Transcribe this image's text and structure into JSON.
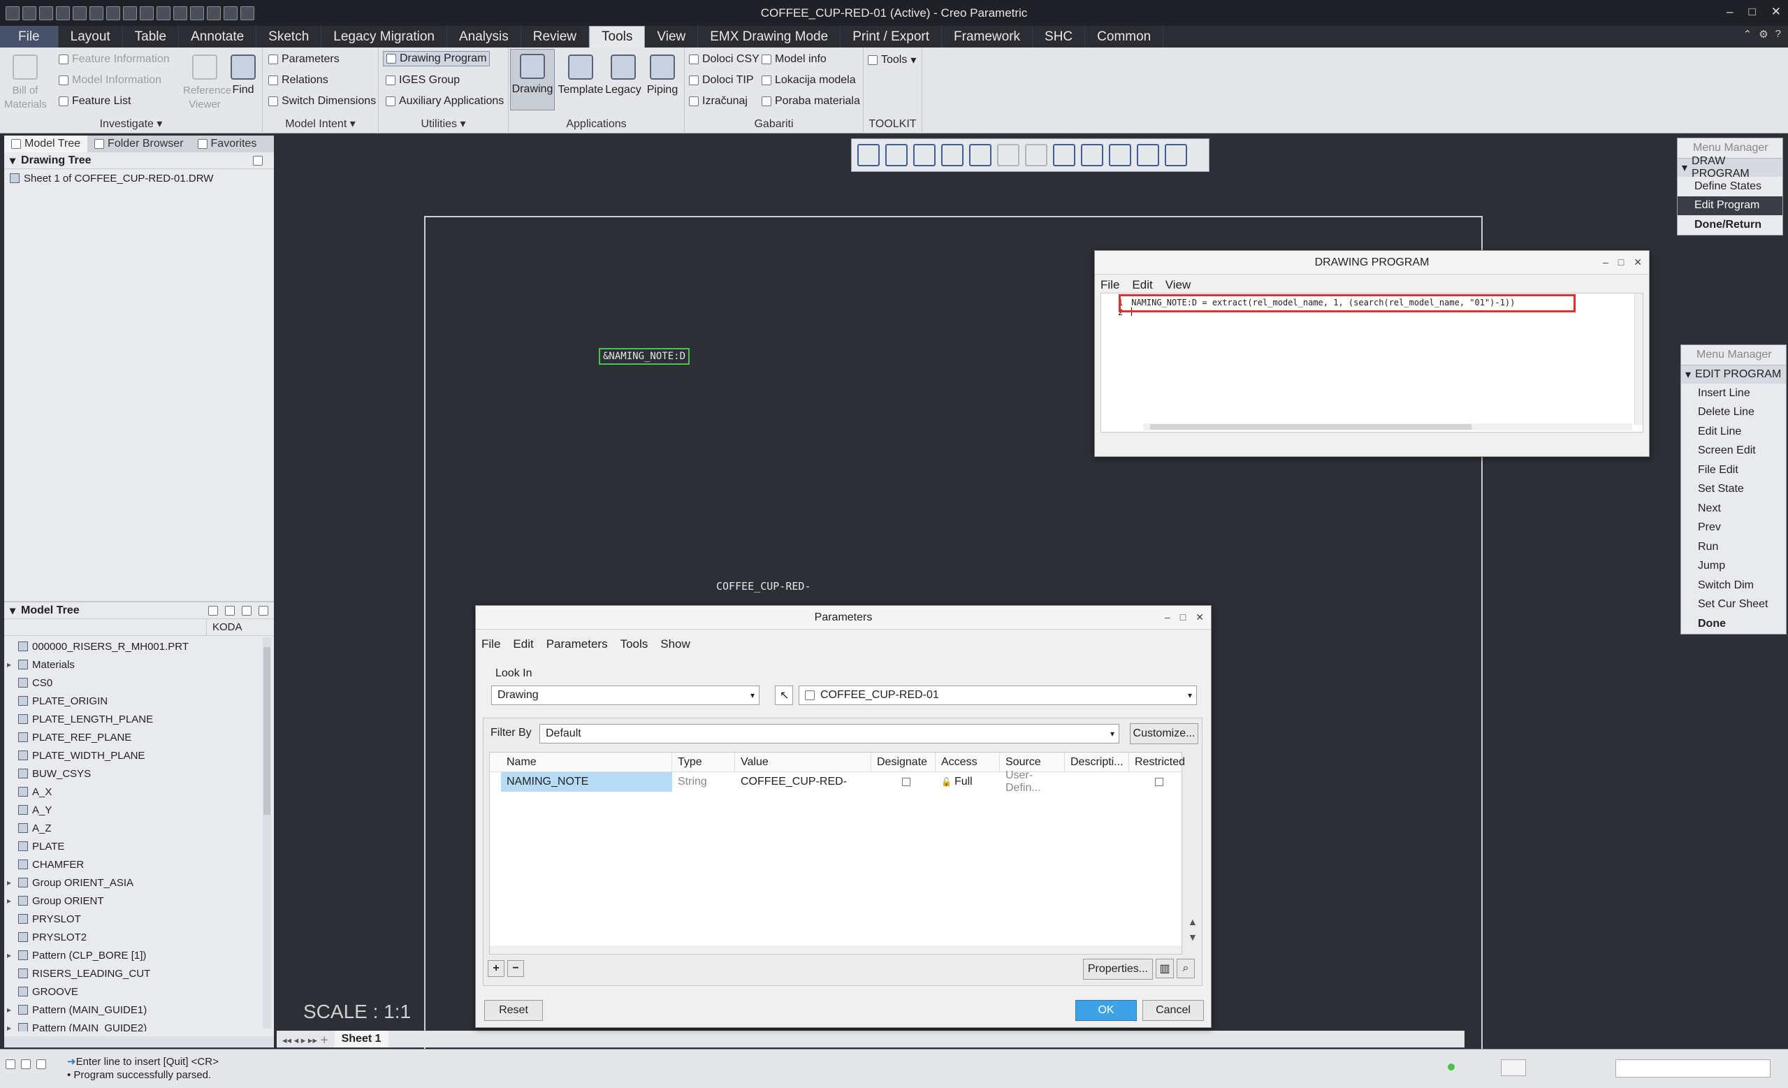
{
  "window": {
    "title": "COFFEE_CUP-RED-01 (Active) - Creo Parametric",
    "minimize": "–",
    "maximize": "□",
    "close": "✕"
  },
  "tabs": [
    "File",
    "Layout",
    "Table",
    "Annotate",
    "Sketch",
    "Legacy Migration",
    "Analysis",
    "Review",
    "Tools",
    "View",
    "EMX Drawing Mode",
    "Print / Export",
    "Framework",
    "SHC",
    "Common"
  ],
  "ribbon": {
    "investigate": {
      "label": "Investigate",
      "bill": "Bill of Materials",
      "feature_info": "Feature Information",
      "model_info": "Model Information",
      "feature_list": "Feature List",
      "reference_viewer": "Reference Viewer",
      "find": "Find"
    },
    "model_intent": {
      "label": "Model Intent",
      "parameters": "Parameters",
      "relations": "Relations",
      "switch_dimensions": "Switch Dimensions"
    },
    "utilities": {
      "label": "Utilities",
      "drawing_program": "Drawing Program",
      "iges_group": "IGES Group",
      "auxiliary_applications": "Auxiliary Applications"
    },
    "applications": {
      "label": "Applications",
      "drawing": "Drawing",
      "template": "Template",
      "legacy": "Legacy",
      "piping": "Piping"
    },
    "gabariti": {
      "label": "Gabariti",
      "doloci_csy": "Doloci CSY",
      "doloci_tip": "Doloci TIP",
      "izracunaj": "Izračunaj",
      "model_info": "Model info",
      "lokacija_modela": "Lokacija modela",
      "poraba_materiala": "Poraba materiala"
    },
    "toolkit": {
      "label": "TOOLKIT",
      "tools": "Tools"
    }
  },
  "left_panel": {
    "tabs": [
      "Model Tree",
      "Folder Browser",
      "Favorites"
    ],
    "drawing_tree_title": "Drawing Tree",
    "drawing_tree_items": [
      "Sheet 1 of COFFEE_CUP-RED-01.DRW"
    ],
    "model_tree_title": "Model Tree",
    "model_tree_column": "KODA",
    "model_tree_items": [
      {
        "label": "000000_RISERS_R_MH001.PRT",
        "expand": ""
      },
      {
        "label": "Materials",
        "expand": "▸"
      },
      {
        "label": "CS0",
        "expand": ""
      },
      {
        "label": "PLATE_ORIGIN",
        "expand": ""
      },
      {
        "label": "PLATE_LENGTH_PLANE",
        "expand": ""
      },
      {
        "label": "PLATE_REF_PLANE",
        "expand": ""
      },
      {
        "label": "PLATE_WIDTH_PLANE",
        "expand": ""
      },
      {
        "label": "BUW_CSYS",
        "expand": ""
      },
      {
        "label": "A_X",
        "expand": ""
      },
      {
        "label": "A_Y",
        "expand": ""
      },
      {
        "label": "A_Z",
        "expand": ""
      },
      {
        "label": "PLATE",
        "expand": ""
      },
      {
        "label": "CHAMFER",
        "expand": ""
      },
      {
        "label": "Group ORIENT_ASIA",
        "expand": "▸"
      },
      {
        "label": "Group ORIENT",
        "expand": "▸"
      },
      {
        "label": "PRYSLOT",
        "expand": ""
      },
      {
        "label": "PRYSLOT2",
        "expand": ""
      },
      {
        "label": "Pattern (CLP_BORE [1])",
        "expand": "▸"
      },
      {
        "label": "RISERS_LEADING_CUT",
        "expand": ""
      },
      {
        "label": "GROOVE",
        "expand": ""
      },
      {
        "label": "Pattern (MAIN_GUIDE1)",
        "expand": "▸"
      },
      {
        "label": "Pattern (MAIN_GUIDE2)",
        "expand": "▸"
      }
    ]
  },
  "canvas": {
    "naming_note": "&NAMING_NOTE:D",
    "coffee_text": "COFFEE_CUP-RED-",
    "scale": "SCALE : 1:1",
    "sheet_tab": "Sheet 1"
  },
  "drawing_program": {
    "title": "DRAWING PROGRAM",
    "menu": [
      "File",
      "Edit",
      "View"
    ],
    "lines": [
      {
        "num": "1",
        "code": "NAMING_NOTE:D = extract(rel_model_name, 1, (search(rel_model_name, \"01\")-1))"
      },
      {
        "num": "2",
        "code": ""
      }
    ]
  },
  "parameters": {
    "title": "Parameters",
    "menu": [
      "File",
      "Edit",
      "Parameters",
      "Tools",
      "Show"
    ],
    "look_in_label": "Look In",
    "look_in_value": "Drawing",
    "object_value": "COFFEE_CUP-RED-01",
    "filter_label": "Filter By",
    "filter_value": "Default",
    "customize": "Customize...",
    "columns": [
      "Name",
      "Type",
      "Value",
      "Designate",
      "Access",
      "Source",
      "Descripti...",
      "Restricted"
    ],
    "rows": [
      {
        "name": "NAMING_NOTE",
        "type": "String",
        "value": "COFFEE_CUP-RED-",
        "designate": false,
        "access": "Full",
        "source": "User-Defin...",
        "description": "",
        "restricted": false
      }
    ],
    "properties": "Properties...",
    "reset": "Reset",
    "ok": "OK",
    "cancel": "Cancel"
  },
  "menu_manager_draw": {
    "title": "Menu Manager",
    "section": "DRAW PROGRAM",
    "items": [
      "Define States",
      "Edit Program",
      "Done/Return"
    ],
    "selected": "Edit Program"
  },
  "menu_manager_edit": {
    "title": "Menu Manager",
    "section": "EDIT PROGRAM",
    "items": [
      "Insert Line",
      "Delete Line",
      "Edit Line",
      "Screen Edit",
      "File Edit",
      "Set State",
      "Next",
      "Prev",
      "Run",
      "Jump",
      "Switch Dim",
      "Set Cur Sheet",
      "Done"
    ]
  },
  "status": {
    "line1": "Enter line to insert [Quit]   <CR>",
    "line2": "Program successfully parsed."
  },
  "colors": {
    "canvas": "#2d2f36",
    "ribbon": "#e4e6ea",
    "highlight": "#e03030",
    "note_green": "#4cc24c",
    "ok_blue": "#3ea3e6"
  }
}
